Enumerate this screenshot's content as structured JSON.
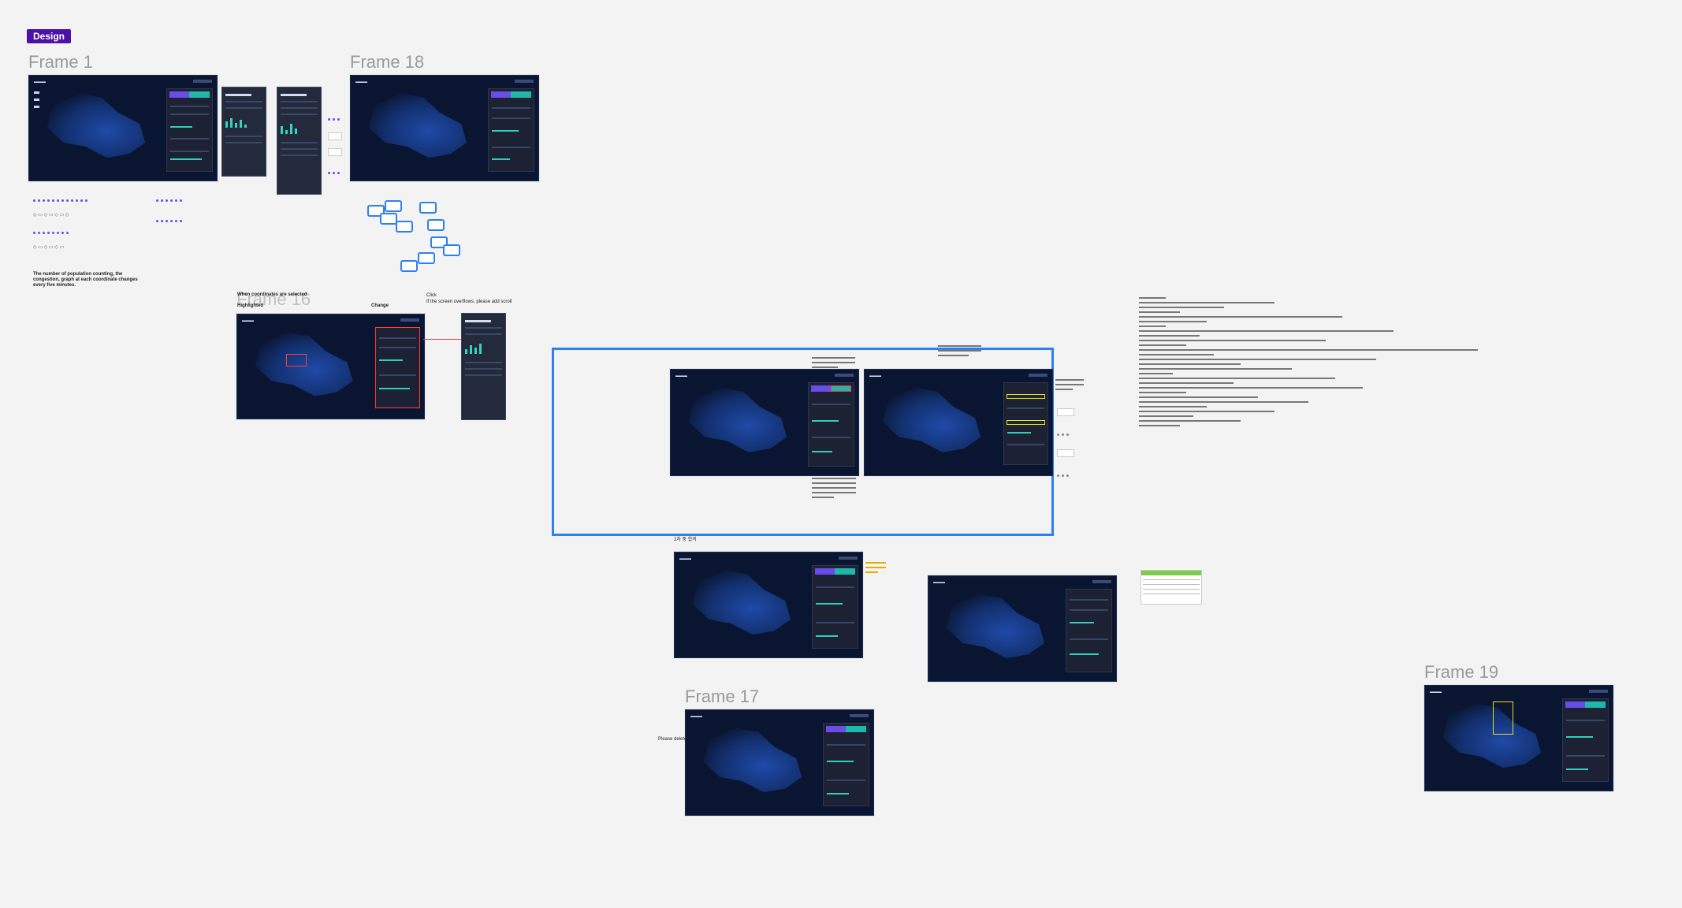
{
  "canvas": {
    "badge": "Design",
    "frames": [
      {
        "label": "Frame 1"
      },
      {
        "label": "Frame 18"
      },
      {
        "label": "Frame 16"
      },
      {
        "label": "Frame 17"
      },
      {
        "label": "Frame 19"
      }
    ]
  },
  "notes": {
    "population_note": "The number of population counting, the congestion, graph at each coordinate changes every five minutes.",
    "coord_selected": "When coordinates are selected",
    "highlighted": "Highlighted",
    "change": "Change",
    "click": "Click",
    "overflow": "If the screen overflows, please add scroll",
    "please_delete": "Please delete it",
    "frame16_hint": "2차 중 합의"
  },
  "colors": {
    "canvas_bg": "#f3f3f3",
    "screen_bg": "#0a1531",
    "panel_bg": "#1c2233",
    "accent_purple": "#6a4de8",
    "accent_teal": "#1fb8a8",
    "selection_blue": "#2f7ff0",
    "highlight_red": "#ff3b3b",
    "badge_purple": "#4b11a8"
  }
}
